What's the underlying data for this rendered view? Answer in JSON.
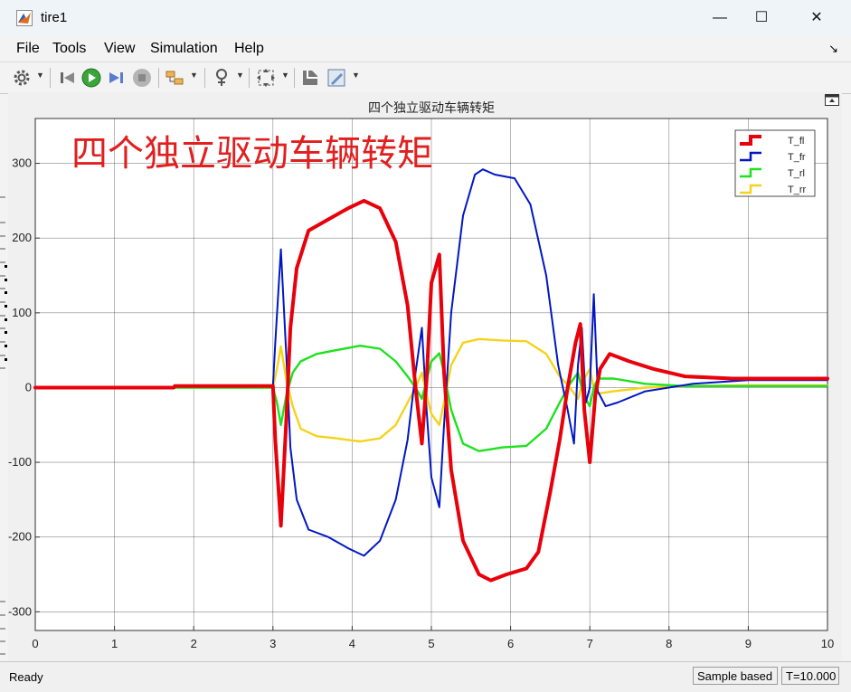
{
  "window": {
    "title": "tire1",
    "minimize": "—",
    "maximize": "☐",
    "close": "✕"
  },
  "menu": [
    "File",
    "Tools",
    "View",
    "Simulation",
    "Help"
  ],
  "toolbar": {
    "icons": [
      "settings-icon",
      "step-back-icon",
      "run-icon",
      "step-forward-icon",
      "stop-icon",
      "signal-select-icon",
      "triggers-icon",
      "zoom-fit-icon",
      "highlight-icon",
      "edit-icon"
    ]
  },
  "status": {
    "ready": "Ready",
    "sample": "Sample based",
    "time": "T=10.000"
  },
  "colors": {
    "red": "#e8000b",
    "blue": "#0017c4",
    "green": "#1de21d",
    "yellow": "#f5d31a"
  },
  "chart_data": {
    "type": "line",
    "title": "四个独立驱动车辆转矩",
    "annotation": "四个独立驱动车辆转矩",
    "xlim": [
      0,
      10
    ],
    "ylim": [
      -325,
      360
    ],
    "xticks": [
      "0",
      "1",
      "2",
      "3",
      "4",
      "5",
      "6",
      "7",
      "8",
      "9",
      "10"
    ],
    "yticks": [
      "300",
      "200",
      "100",
      "0",
      "-100",
      "-200",
      "-300"
    ],
    "legend_position": "top-right",
    "grid": true,
    "series": [
      {
        "name": "T_fl",
        "color": "#e8000b",
        "points": [
          [
            0,
            0
          ],
          [
            1.75,
            0
          ],
          [
            1.76,
            2
          ],
          [
            3.0,
            2
          ],
          [
            3.03,
            -70
          ],
          [
            3.1,
            -185
          ],
          [
            3.17,
            -40
          ],
          [
            3.22,
            80
          ],
          [
            3.3,
            160
          ],
          [
            3.45,
            210
          ],
          [
            3.7,
            225
          ],
          [
            3.95,
            240
          ],
          [
            4.15,
            250
          ],
          [
            4.35,
            240
          ],
          [
            4.55,
            195
          ],
          [
            4.7,
            110
          ],
          [
            4.8,
            0
          ],
          [
            4.88,
            -75
          ],
          [
            4.94,
            10
          ],
          [
            5.0,
            140
          ],
          [
            5.1,
            178
          ],
          [
            5.16,
            20
          ],
          [
            5.25,
            -110
          ],
          [
            5.4,
            -205
          ],
          [
            5.6,
            -250
          ],
          [
            5.75,
            -258
          ],
          [
            5.95,
            -250
          ],
          [
            6.2,
            -242
          ],
          [
            6.35,
            -220
          ],
          [
            6.5,
            -140
          ],
          [
            6.62,
            -70
          ],
          [
            6.72,
            0
          ],
          [
            6.82,
            60
          ],
          [
            6.88,
            85
          ],
          [
            6.93,
            -30
          ],
          [
            7.0,
            -100
          ],
          [
            7.07,
            -10
          ],
          [
            7.13,
            25
          ],
          [
            7.25,
            45
          ],
          [
            7.5,
            35
          ],
          [
            7.8,
            25
          ],
          [
            8.2,
            15
          ],
          [
            8.8,
            12
          ],
          [
            9.5,
            12
          ],
          [
            10,
            12
          ]
        ]
      },
      {
        "name": "T_fr",
        "color": "#0017c4",
        "points": [
          [
            0,
            0
          ],
          [
            1.75,
            0
          ],
          [
            1.76,
            2
          ],
          [
            3.0,
            2
          ],
          [
            3.03,
            60
          ],
          [
            3.1,
            185
          ],
          [
            3.17,
            40
          ],
          [
            3.22,
            -80
          ],
          [
            3.3,
            -150
          ],
          [
            3.45,
            -190
          ],
          [
            3.7,
            -200
          ],
          [
            3.95,
            -215
          ],
          [
            4.15,
            -225
          ],
          [
            4.35,
            -205
          ],
          [
            4.55,
            -150
          ],
          [
            4.7,
            -70
          ],
          [
            4.8,
            20
          ],
          [
            4.88,
            80
          ],
          [
            4.94,
            -30
          ],
          [
            5.0,
            -120
          ],
          [
            5.1,
            -160
          ],
          [
            5.16,
            -50
          ],
          [
            5.25,
            100
          ],
          [
            5.4,
            230
          ],
          [
            5.55,
            285
          ],
          [
            5.65,
            292
          ],
          [
            5.8,
            285
          ],
          [
            6.05,
            280
          ],
          [
            6.25,
            245
          ],
          [
            6.45,
            150
          ],
          [
            6.6,
            30
          ],
          [
            6.72,
            -30
          ],
          [
            6.8,
            -75
          ],
          [
            6.85,
            30
          ],
          [
            6.9,
            80
          ],
          [
            6.95,
            -20
          ],
          [
            7.0,
            0
          ],
          [
            7.05,
            125
          ],
          [
            7.1,
            -5
          ],
          [
            7.2,
            -25
          ],
          [
            7.35,
            -20
          ],
          [
            7.7,
            -5
          ],
          [
            8.3,
            5
          ],
          [
            9.0,
            10
          ],
          [
            10,
            10
          ]
        ]
      },
      {
        "name": "T_rl",
        "color": "#1de21d",
        "points": [
          [
            0,
            0
          ],
          [
            1.75,
            0
          ],
          [
            3.0,
            0
          ],
          [
            3.05,
            -20
          ],
          [
            3.1,
            -50
          ],
          [
            3.17,
            -10
          ],
          [
            3.25,
            20
          ],
          [
            3.35,
            35
          ],
          [
            3.55,
            45
          ],
          [
            3.8,
            50
          ],
          [
            4.1,
            56
          ],
          [
            4.35,
            52
          ],
          [
            4.55,
            35
          ],
          [
            4.7,
            15
          ],
          [
            4.8,
            0
          ],
          [
            4.88,
            -15
          ],
          [
            4.94,
            10
          ],
          [
            5.0,
            35
          ],
          [
            5.1,
            46
          ],
          [
            5.16,
            20
          ],
          [
            5.25,
            -30
          ],
          [
            5.4,
            -75
          ],
          [
            5.6,
            -85
          ],
          [
            5.9,
            -80
          ],
          [
            6.2,
            -78
          ],
          [
            6.45,
            -55
          ],
          [
            6.62,
            -20
          ],
          [
            6.75,
            5
          ],
          [
            6.85,
            20
          ],
          [
            6.92,
            -10
          ],
          [
            7.0,
            -25
          ],
          [
            7.05,
            0
          ],
          [
            7.1,
            12
          ],
          [
            7.3,
            12
          ],
          [
            7.7,
            5
          ],
          [
            8.2,
            2
          ],
          [
            9.0,
            2
          ],
          [
            10,
            2
          ]
        ]
      },
      {
        "name": "T_rr",
        "color": "#f5d31a",
        "points": [
          [
            0,
            0
          ],
          [
            1.75,
            0
          ],
          [
            3.0,
            0
          ],
          [
            3.05,
            25
          ],
          [
            3.1,
            55
          ],
          [
            3.17,
            10
          ],
          [
            3.25,
            -25
          ],
          [
            3.35,
            -55
          ],
          [
            3.55,
            -65
          ],
          [
            3.8,
            -68
          ],
          [
            4.1,
            -72
          ],
          [
            4.35,
            -68
          ],
          [
            4.55,
            -50
          ],
          [
            4.7,
            -20
          ],
          [
            4.8,
            0
          ],
          [
            4.88,
            20
          ],
          [
            4.94,
            -10
          ],
          [
            5.0,
            -35
          ],
          [
            5.1,
            -50
          ],
          [
            5.16,
            -20
          ],
          [
            5.25,
            30
          ],
          [
            5.4,
            60
          ],
          [
            5.6,
            65
          ],
          [
            5.9,
            63
          ],
          [
            6.2,
            62
          ],
          [
            6.45,
            45
          ],
          [
            6.62,
            15
          ],
          [
            6.75,
            0
          ],
          [
            6.85,
            -15
          ],
          [
            6.92,
            10
          ],
          [
            7.0,
            25
          ],
          [
            7.05,
            0
          ],
          [
            7.1,
            -8
          ],
          [
            7.3,
            -5
          ],
          [
            7.7,
            0
          ],
          [
            8.2,
            2
          ],
          [
            9.0,
            3
          ],
          [
            10,
            3
          ]
        ]
      }
    ]
  }
}
